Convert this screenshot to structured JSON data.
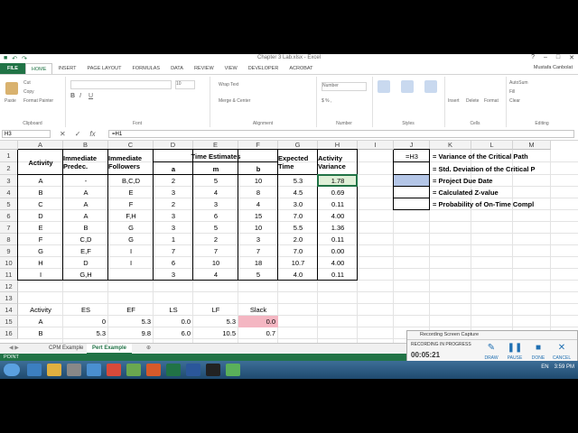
{
  "window": {
    "title": "Chapter 3 Lab.xlsx - Excel",
    "user": "Mustafa Canbolat"
  },
  "ribbon_tabs": [
    "FILE",
    "HOME",
    "INSERT",
    "PAGE LAYOUT",
    "FORMULAS",
    "DATA",
    "REVIEW",
    "VIEW",
    "DEVELOPER",
    "ACROBAT"
  ],
  "ribbon": {
    "clipboard": {
      "paste": "Paste",
      "cut": "Cut",
      "copy": "Copy",
      "painter": "Format Painter",
      "label": "Clipboard"
    },
    "font": {
      "label": "Font",
      "size": "10"
    },
    "alignment": {
      "wrap": "Wrap Text",
      "merge": "Merge & Center",
      "label": "Alignment"
    },
    "number": {
      "format": "Number",
      "label": "Number"
    },
    "styles": {
      "cond": "Conditional Formatting",
      "table": "Format as Table",
      "cell": "Cell Styles",
      "label": "Styles"
    },
    "cells": {
      "insert": "Insert",
      "delete": "Delete",
      "format": "Format",
      "label": "Cells"
    },
    "editing": {
      "autosum": "AutoSum",
      "fill": "Fill",
      "clear": "Clear",
      "sort": "Sort & Filter",
      "find": "Find & Select",
      "label": "Editing"
    }
  },
  "formula_bar": {
    "name_box": "H3",
    "formula": "=H1"
  },
  "columns": [
    "A",
    "B",
    "C",
    "D",
    "E",
    "F",
    "G",
    "H",
    "I",
    "J",
    "K",
    "L",
    "M"
  ],
  "rows": [
    "1",
    "2",
    "3",
    "4",
    "5",
    "6",
    "7",
    "8",
    "9",
    "10",
    "11",
    "12",
    "13",
    "14",
    "15",
    "16"
  ],
  "headers": {
    "activity": "Activity",
    "immediate_predec": "Immediate Predec.",
    "immediate_followers": "Immediate Followers",
    "time_estimates": "Time Estimates",
    "a": "a",
    "m": "m",
    "b": "b",
    "expected_time": "Expected Time",
    "activity_variance": "Activity Variance"
  },
  "table": [
    [
      "A",
      "-",
      "B,C,D",
      "2",
      "5",
      "10",
      "5.3",
      "1.78"
    ],
    [
      "B",
      "A",
      "E",
      "3",
      "4",
      "8",
      "4.5",
      "0.69"
    ],
    [
      "C",
      "A",
      "F",
      "2",
      "3",
      "4",
      "3.0",
      "0.11"
    ],
    [
      "D",
      "A",
      "F,H",
      "3",
      "6",
      "15",
      "7.0",
      "4.00"
    ],
    [
      "E",
      "B",
      "G",
      "3",
      "5",
      "10",
      "5.5",
      "1.36"
    ],
    [
      "F",
      "C,D",
      "G",
      "1",
      "2",
      "3",
      "2.0",
      "0.11"
    ],
    [
      "G",
      "E,F",
      "I",
      "7",
      "7",
      "7",
      "7.0",
      "0.00"
    ],
    [
      "H",
      "D",
      "I",
      "6",
      "10",
      "18",
      "10.7",
      "4.00"
    ],
    [
      "I",
      "G,H",
      "",
      "3",
      "4",
      "5",
      "4.0",
      "0.11"
    ]
  ],
  "side_cells": {
    "j1": "=H3",
    "k1": "= Variance of the Critical Path",
    "k2": "= Std. Deviation of the Critical P",
    "k3": "= Project Due Date",
    "k4": "= Calculated Z-value",
    "k5": "= Probability of On-Time Compl"
  },
  "lower_headers": [
    "Activity",
    "ES",
    "EF",
    "LS",
    "LF",
    "Slack"
  ],
  "lower_rows": [
    [
      "A",
      "0",
      "5.3",
      "0.0",
      "5.3",
      "0.0"
    ],
    [
      "B",
      "5.3",
      "9.8",
      "6.0",
      "10.5",
      "0.7"
    ]
  ],
  "sheet_tabs": [
    "CPM Example",
    "Pert Example"
  ],
  "status": "POINT",
  "recorder": {
    "title": "Recording Screen Capture",
    "state": "RECORDING IN PROGRESS",
    "time": "00:05:21",
    "buttons": [
      "DRAW",
      "PAUSE",
      "DONE",
      "CANCEL"
    ]
  },
  "taskbar": {
    "lang": "EN",
    "clock": "3:59 PM"
  },
  "colors": {
    "excel_green": "#217346",
    "highlight_blue": "#b4c6e7",
    "highlight_pink": "#f4b6c2",
    "selected_green": "#dff0d8"
  }
}
